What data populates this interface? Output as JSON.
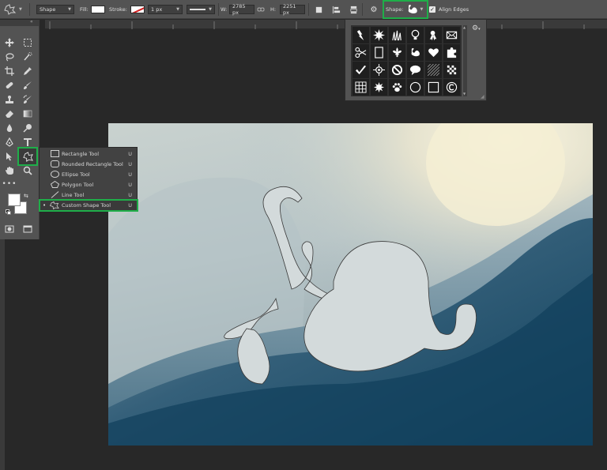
{
  "options_bar": {
    "mode_value": "Shape",
    "fill_label": "Fill:",
    "stroke_label": "Stroke:",
    "stroke_width": "1 px",
    "w_label": "W:",
    "w_value": "2785 px",
    "h_label": "H:",
    "h_value": "2251 px",
    "shape_label": "Shape:",
    "align_edges_label": "Align Edges",
    "align_edges_checked": true
  },
  "flyout": {
    "items": [
      {
        "label": "Rectangle Tool",
        "key": "U",
        "icon": "rectangle-icon"
      },
      {
        "label": "Rounded Rectangle Tool",
        "key": "U",
        "icon": "rounded-rectangle-icon"
      },
      {
        "label": "Ellipse Tool",
        "key": "U",
        "icon": "ellipse-icon"
      },
      {
        "label": "Polygon Tool",
        "key": "U",
        "icon": "polygon-icon"
      },
      {
        "label": "Line Tool",
        "key": "U",
        "icon": "line-icon"
      },
      {
        "label": "Custom Shape Tool",
        "key": "U",
        "icon": "custom-shape-icon",
        "selected": true
      }
    ]
  },
  "shape_picker": {
    "shapes": [
      "lightning",
      "starburst",
      "grass",
      "lightbulb",
      "ribbon",
      "envelope",
      "scissors",
      "frame",
      "fleur-de-lis",
      "snail",
      "heart",
      "puzzle",
      "checkmark",
      "target",
      "no-sign",
      "speech-bubble",
      "hatching",
      "checkerboard",
      "grid",
      "burst",
      "paw",
      "circle",
      "square",
      "copyright"
    ]
  },
  "colors": {
    "accent": "#1fae49",
    "panel": "#535353",
    "background": "#282828"
  }
}
